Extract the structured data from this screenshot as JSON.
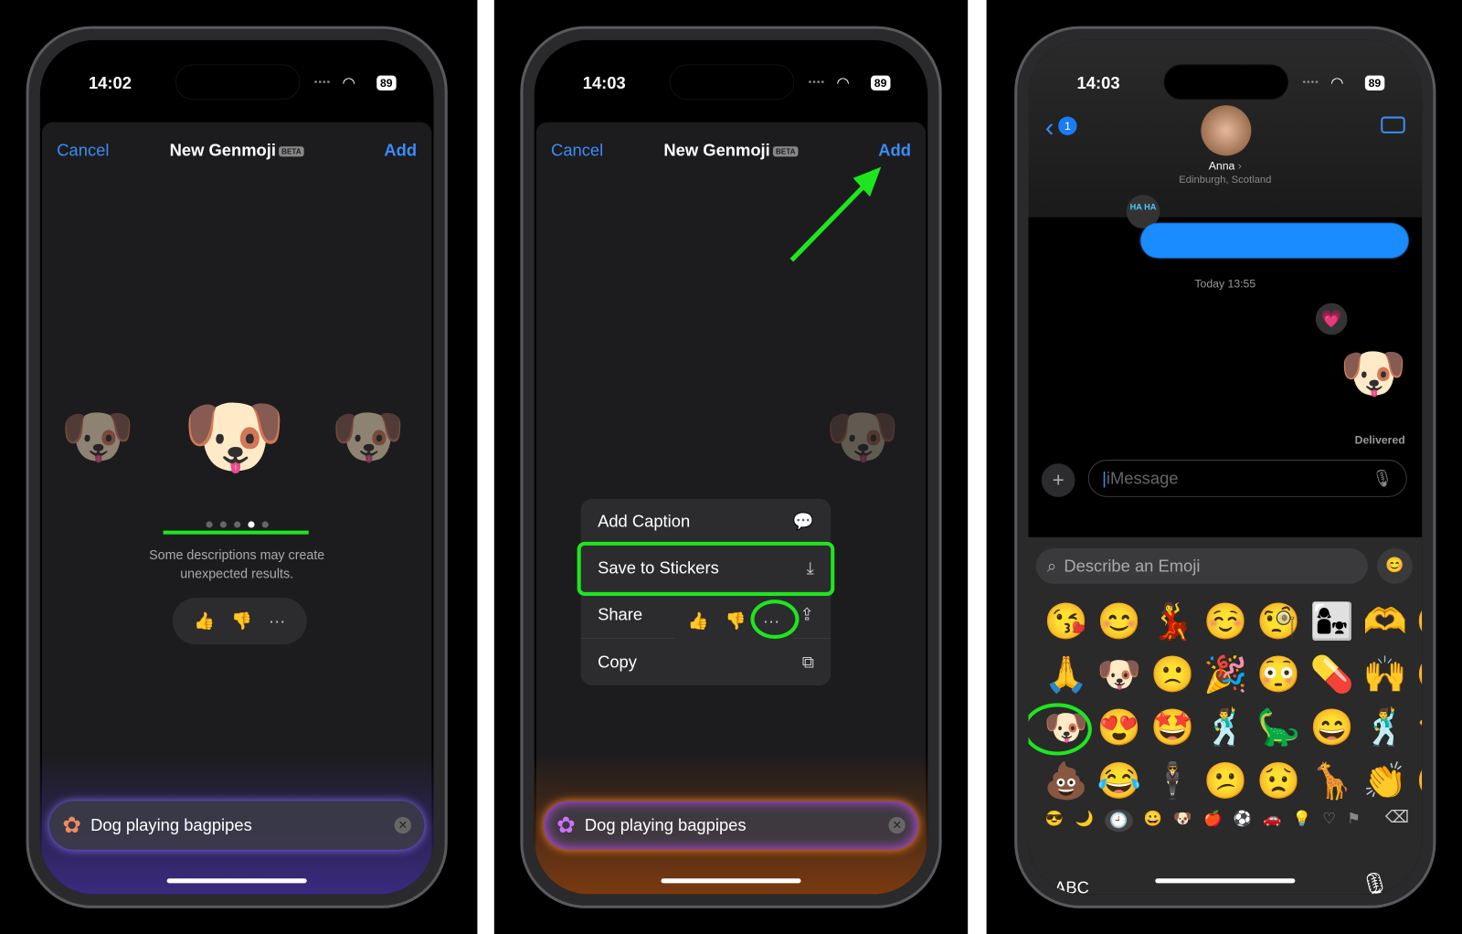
{
  "screens": [
    {
      "status": {
        "time": "14:02",
        "battery": "89"
      },
      "nav": {
        "cancel": "Cancel",
        "title": "New Genmoji",
        "badge": "BETA",
        "add": "Add"
      },
      "page_index": 4,
      "page_count": 5,
      "note": "Some descriptions may create unexpected results.",
      "feedback": {
        "like": "👍",
        "dislike": "👎",
        "more": "···"
      },
      "prompt": {
        "text": "Dog playing bagpipes"
      },
      "glow_color": "#7a5cff"
    },
    {
      "status": {
        "time": "14:03",
        "battery": "89"
      },
      "nav": {
        "cancel": "Cancel",
        "title": "New Genmoji",
        "badge": "BETA",
        "add": "Add"
      },
      "menu": [
        {
          "label": "Add Caption",
          "icon": "caption-icon"
        },
        {
          "label": "Save to Stickers",
          "icon": "save-sticker-icon",
          "highlighted": true
        },
        {
          "label": "Share",
          "icon": "share-icon"
        },
        {
          "label": "Copy",
          "icon": "copy-icon"
        }
      ],
      "feedback": {
        "like": "👍",
        "dislike": "👎",
        "more": "···"
      },
      "prompt": {
        "text": "Dog playing bagpipes"
      },
      "glow_color": "#ff8a20"
    },
    {
      "status": {
        "time": "14:03",
        "battery": "89"
      },
      "header": {
        "back_badge": "1",
        "contact": "Anna",
        "location": "Edinburgh, Scotland"
      },
      "tapback": "HA HA",
      "timestamp": "Today 13:55",
      "delivered": "Delivered",
      "input": {
        "placeholder": "iMessage"
      },
      "emoji_search": {
        "placeholder": "Describe an Emoji"
      },
      "emojis": [
        "😘",
        "😊",
        "💃",
        "☺️",
        "🧐",
        "👩‍👧",
        "🫶",
        "😀",
        "🙏",
        "🐶",
        "🙁",
        "🎉",
        "😳",
        "💊",
        "🙌",
        "😶",
        "🐶",
        "😍",
        "🤩",
        "🕺",
        "🦕",
        "😄",
        "🕺",
        "👈",
        "💩",
        "😂",
        "🕴",
        "😕",
        "😟",
        "🦒",
        "👏",
        "😁"
      ],
      "categories": [
        "😎",
        "🌙",
        "🕘",
        "😀",
        "🐶",
        "🍎",
        "⚽",
        "🚗",
        "💡",
        "♡",
        "⚑"
      ],
      "abc": "ABC",
      "accent": "#1ee61e"
    }
  ]
}
